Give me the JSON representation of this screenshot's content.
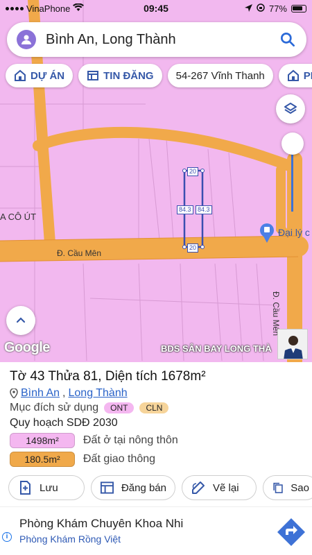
{
  "status_bar": {
    "carrier": "VinaPhone",
    "time": "09:45",
    "battery": "77%"
  },
  "search": {
    "value": "Bình An, Long Thành"
  },
  "chips": [
    {
      "label": "DỰ ÁN",
      "icon": "home-icon"
    },
    {
      "label": "TIN ĐĂNG",
      "icon": "listing-icon"
    },
    {
      "label": "54-267 Vĩnh Thanh"
    },
    {
      "label": "PK",
      "icon": "home-icon"
    }
  ],
  "map": {
    "labels": {
      "street_1": "Đ. Cầu Mên",
      "street_2": "Đ. Cầu Mên",
      "place_left": "A CÔ ÚT",
      "poi": "Đại lý c"
    },
    "dimensions": {
      "top": "20",
      "bottom": "20",
      "left": "84.3",
      "right": "84.3"
    },
    "logo": "Google",
    "watermark": "BDS SÂN BAY LONG THÀ",
    "colors": {
      "land": "#f2b8ef",
      "road": "#f1a94a",
      "parcel_outline": "#3a4fb0"
    }
  },
  "parcel": {
    "sheet_label": "Tờ 43 Thửa 81, Diện tích 1678m²",
    "ward": "Bình An",
    "separator": ",",
    "district": "Long Thành",
    "purpose_label": "Mục đích sử dụng",
    "purpose_tags": [
      "ONT",
      "CLN"
    ],
    "planning_label": "Quy hoạch SDĐ 2030",
    "land_uses": [
      {
        "area": "1498m²",
        "label": "Đất ở tại nông thôn",
        "color": "#f4b7f0"
      },
      {
        "area": "180.5m²",
        "label": "Đất giao thông",
        "color": "#f0a94a"
      }
    ]
  },
  "actions": [
    {
      "label": "Lưu",
      "icon": "add-bookmark-icon"
    },
    {
      "label": "Đăng bán",
      "icon": "listing-icon"
    },
    {
      "label": "Vẽ lại",
      "icon": "draw-icon"
    },
    {
      "label": "Sao",
      "icon": "copy-icon"
    }
  ],
  "ad": {
    "title": "Phòng Khám Chuyên Khoa Nhi",
    "subtitle": "Phòng Khám Rồng Việt",
    "info_glyph": "i"
  }
}
